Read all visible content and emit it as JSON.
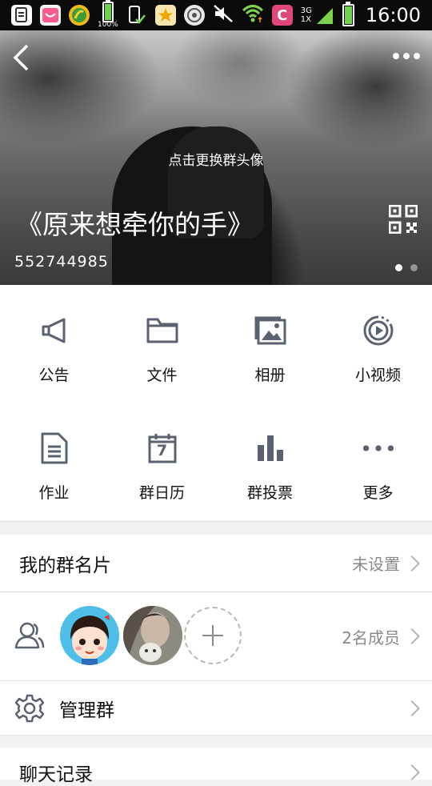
{
  "status_bar": {
    "battery_percent": "100%",
    "network_3g": "3G",
    "network_1x": "1X",
    "time": "16:00"
  },
  "header": {
    "change_avatar_hint": "点击更换群头像",
    "group_name": "《原来想牵你的手》",
    "group_id": "552744985",
    "page_dots": 2,
    "active_dot": 0
  },
  "features": [
    {
      "label": "公告",
      "icon": "megaphone-icon"
    },
    {
      "label": "文件",
      "icon": "folder-icon"
    },
    {
      "label": "相册",
      "icon": "album-icon"
    },
    {
      "label": "小视频",
      "icon": "video-icon"
    },
    {
      "label": "作业",
      "icon": "document-icon"
    },
    {
      "label": "群日历",
      "icon": "calendar-icon"
    },
    {
      "label": "群投票",
      "icon": "bar-chart-icon"
    },
    {
      "label": "更多",
      "icon": "more-icon"
    }
  ],
  "calendar_day": "7",
  "rows": {
    "card": {
      "label": "我的群名片",
      "value": "未设置"
    },
    "members": {
      "value": "2名成员"
    },
    "manage": {
      "label": "管理群"
    },
    "next": {
      "label": "聊天记录"
    }
  },
  "colors": {
    "icon": "#5a6170",
    "accent_battery": "#6fd24a",
    "chevron": "#b3b3b3"
  }
}
